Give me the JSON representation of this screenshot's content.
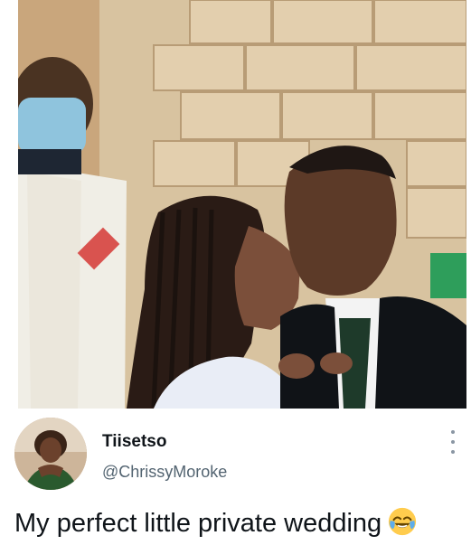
{
  "tweet": {
    "display_name": "Tiisetso",
    "handle": "@ChrissyMoroke",
    "text": "My perfect little private wedding",
    "emoji": "face-with-tears-of-joy-emoji"
  },
  "icons": {
    "more": "more-vertical-icon"
  },
  "colors": {
    "text_primary": "#0f1419",
    "text_secondary": "#536471",
    "background": "#ffffff"
  }
}
